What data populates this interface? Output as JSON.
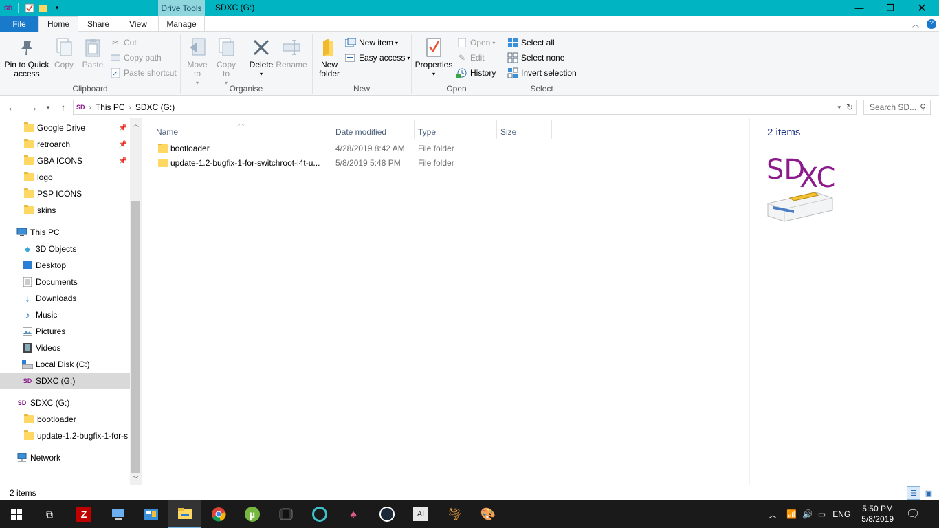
{
  "titlebar": {
    "context_tab": "Drive Tools",
    "title": "SDXC (G:)",
    "minimize_icon": "minimize-icon",
    "restore_icon": "restore-icon",
    "close_icon": "close-icon"
  },
  "tabs": {
    "file": "File",
    "home": "Home",
    "share": "Share",
    "view": "View",
    "manage": "Manage"
  },
  "ribbon": {
    "clipboard": {
      "label": "Clipboard",
      "pin": "Pin to Quick access",
      "pin_l1": "Pin to Quick",
      "pin_l2": "access",
      "copy": "Copy",
      "paste": "Paste",
      "cut": "Cut",
      "copy_path": "Copy path",
      "paste_shortcut": "Paste shortcut"
    },
    "organise": {
      "label": "Organise",
      "move_l1": "Move",
      "move_l2": "to",
      "copy_l1": "Copy",
      "copy_l2": "to",
      "delete": "Delete",
      "rename": "Rename"
    },
    "new": {
      "label": "New",
      "folder_l1": "New",
      "folder_l2": "folder",
      "new_item": "New item",
      "easy_access": "Easy access"
    },
    "open": {
      "label": "Open",
      "properties": "Properties",
      "open": "Open",
      "edit": "Edit",
      "history": "History"
    },
    "select": {
      "label": "Select",
      "select_all": "Select all",
      "select_none": "Select none",
      "invert": "Invert selection"
    }
  },
  "address": {
    "crumbs": [
      "This PC",
      "SDXC (G:)"
    ],
    "search_placeholder": "Search SD..."
  },
  "navpane": {
    "quick_access": [
      {
        "label": "Google Drive",
        "pinned": true
      },
      {
        "label": "retroarch",
        "pinned": true
      },
      {
        "label": "GBA ICONS",
        "pinned": true
      },
      {
        "label": "logo",
        "pinned": false
      },
      {
        "label": "PSP ICONS",
        "pinned": false
      },
      {
        "label": "skins",
        "pinned": false
      }
    ],
    "this_pc": "This PC",
    "pc_items": [
      "3D Objects",
      "Desktop",
      "Documents",
      "Downloads",
      "Music",
      "Pictures",
      "Videos",
      "Local Disk (C:)",
      "SDXC (G:)"
    ],
    "drive": "SDXC (G:)",
    "drive_items": [
      "bootloader",
      "update-1.2-bugfix-1-for-s"
    ],
    "network": "Network"
  },
  "columns": {
    "name": "Name",
    "date": "Date modified",
    "type": "Type",
    "size": "Size"
  },
  "files": [
    {
      "name": "bootloader",
      "date": "4/28/2019 8:42 AM",
      "type": "File folder",
      "size": ""
    },
    {
      "name": "update-1.2-bugfix-1-for-switchroot-l4t-u...",
      "date": "5/8/2019 5:48 PM",
      "type": "File folder",
      "size": ""
    }
  ],
  "details": {
    "count": "2 items",
    "logo_sd": "SD",
    "logo_xc": "XC"
  },
  "status": {
    "count": "2 items"
  },
  "taskbar": {
    "apps": [
      "start-icon",
      "task-view-icon",
      "filezilla-icon",
      "this-pc-icon",
      "control-panel-icon",
      "file-explorer-icon",
      "chrome-icon",
      "utorrent-icon",
      "switch-icon",
      "app-icon",
      "playstation-icon",
      "steam-icon",
      "ai-icon",
      "tornado-icon",
      "paint-icon"
    ],
    "lang": "ENG",
    "time": "5:50 PM",
    "date": "5/8/2019"
  },
  "colors": {
    "titlebar": "#00b4c2",
    "file_tab": "#1979ca",
    "sdxc_purple": "#8b1a8b",
    "folder": "#ffd863"
  }
}
